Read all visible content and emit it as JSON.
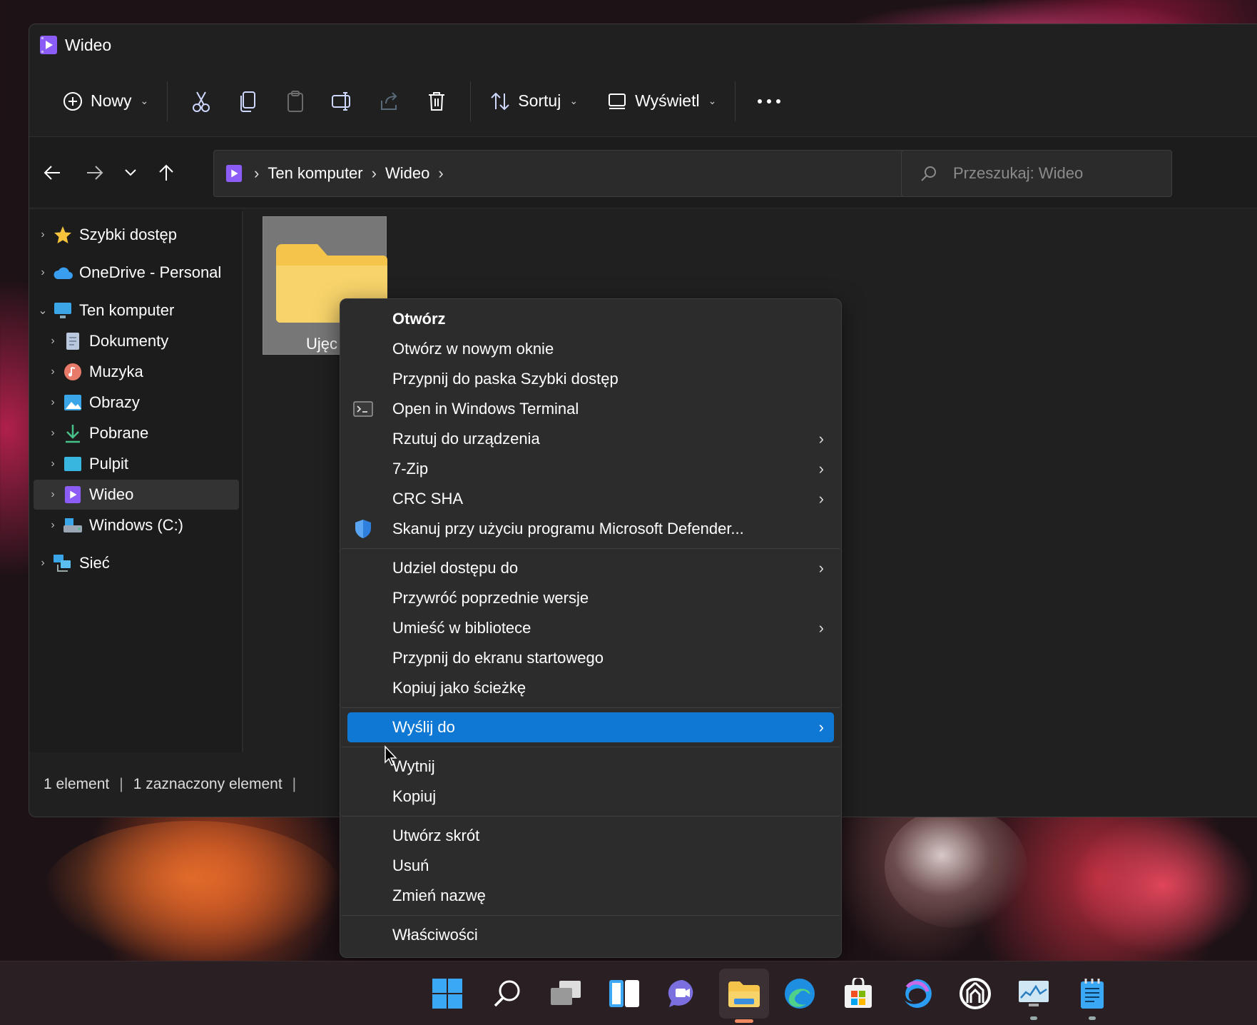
{
  "window": {
    "title": "Wideo"
  },
  "toolbar": {
    "new_label": "Nowy",
    "sort_label": "Sortuj",
    "view_label": "Wyświetl",
    "icons": [
      "plus-circle-icon",
      "cut-icon",
      "copy-icon",
      "paste-icon",
      "rename-icon",
      "share-icon",
      "delete-icon",
      "sort-icon",
      "view-icon",
      "more-icon"
    ]
  },
  "address": {
    "crumbs": [
      "Ten komputer",
      "Wideo"
    ],
    "search_placeholder": "Przeszukaj: Wideo"
  },
  "sidebar": {
    "items": [
      {
        "label": "Szybki dostęp",
        "icon": "star-icon"
      },
      {
        "label": "OneDrive - Personal",
        "icon": "cloud-icon"
      },
      {
        "label": "Ten komputer",
        "icon": "computer-icon"
      },
      {
        "label": "Dokumenty",
        "icon": "document-icon"
      },
      {
        "label": "Muzyka",
        "icon": "music-icon"
      },
      {
        "label": "Obrazy",
        "icon": "pictures-icon"
      },
      {
        "label": "Pobrane",
        "icon": "download-icon"
      },
      {
        "label": "Pulpit",
        "icon": "desktop-icon"
      },
      {
        "label": "Wideo",
        "icon": "video-icon"
      },
      {
        "label": "Windows (C:)",
        "icon": "drive-icon"
      },
      {
        "label": "Sieć",
        "icon": "network-icon"
      }
    ],
    "selected": "Wideo"
  },
  "content": {
    "folder_label": "Ujęc"
  },
  "status": {
    "count": "1 element",
    "selected": "1 zaznaczony element"
  },
  "context_menu": {
    "items": [
      {
        "label": "Otwórz"
      },
      {
        "label": "Otwórz w nowym oknie"
      },
      {
        "label": "Przypnij do paska Szybki dostęp"
      },
      {
        "label": "Open in Windows Terminal",
        "icon": "terminal-icon"
      },
      {
        "label": "Rzutuj do urządzenia",
        "submenu": true
      },
      {
        "label": "7-Zip",
        "submenu": true
      },
      {
        "label": "CRC SHA",
        "submenu": true
      },
      {
        "label": "Skanuj przy użyciu programu Microsoft Defender...",
        "icon": "defender-shield-icon"
      },
      {
        "label": "Udziel dostępu do",
        "submenu": true
      },
      {
        "label": "Przywróć poprzednie wersje"
      },
      {
        "label": "Umieść w bibliotece",
        "submenu": true
      },
      {
        "label": "Przypnij do ekranu startowego"
      },
      {
        "label": "Kopiuj jako ścieżkę"
      },
      {
        "label": "Wyślij do",
        "submenu": true,
        "highlighted": true
      },
      {
        "label": "Wytnij"
      },
      {
        "label": "Kopiuj"
      },
      {
        "label": "Utwórz skrót"
      },
      {
        "label": "Usuń"
      },
      {
        "label": "Zmień nazwę"
      },
      {
        "label": "Właściwości"
      }
    ]
  },
  "taskbar": {
    "icons": [
      "windows-start-icon",
      "search-icon",
      "task-view-icon",
      "widgets-icon",
      "chat-icon",
      "file-explorer-icon",
      "edge-icon",
      "store-icon",
      "edge-dev-icon",
      "app-icon",
      "performance-icon",
      "notepad-icon"
    ],
    "active": "file-explorer-icon"
  },
  "colors": {
    "accent": "#0e78d4",
    "folder": "#f4c54a",
    "window_bg": "#202020",
    "menu_bg": "#2c2c2c"
  }
}
